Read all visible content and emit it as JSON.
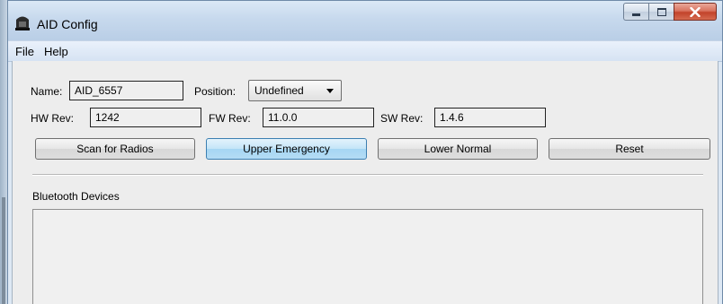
{
  "window": {
    "title": "AID Config"
  },
  "menu": {
    "items": [
      {
        "label": "File"
      },
      {
        "label": "Help"
      }
    ]
  },
  "form": {
    "name_label": "Name:",
    "name_value": "AID_6557",
    "position_label": "Position:",
    "position_value": "Undefined",
    "hw_label": "HW Rev:",
    "hw_value": "1242",
    "fw_label": "FW Rev:",
    "fw_value": "11.0.0",
    "sw_label": "SW Rev:",
    "sw_value": "1.4.6"
  },
  "buttons": {
    "scan": "Scan for Radios",
    "upper": "Upper Emergency",
    "lower": "Lower Normal",
    "reset": "Reset"
  },
  "devices": {
    "label": "Bluetooth Devices"
  },
  "colors": {
    "active_button": "#b4dcf5",
    "close_button": "#c2432a"
  }
}
